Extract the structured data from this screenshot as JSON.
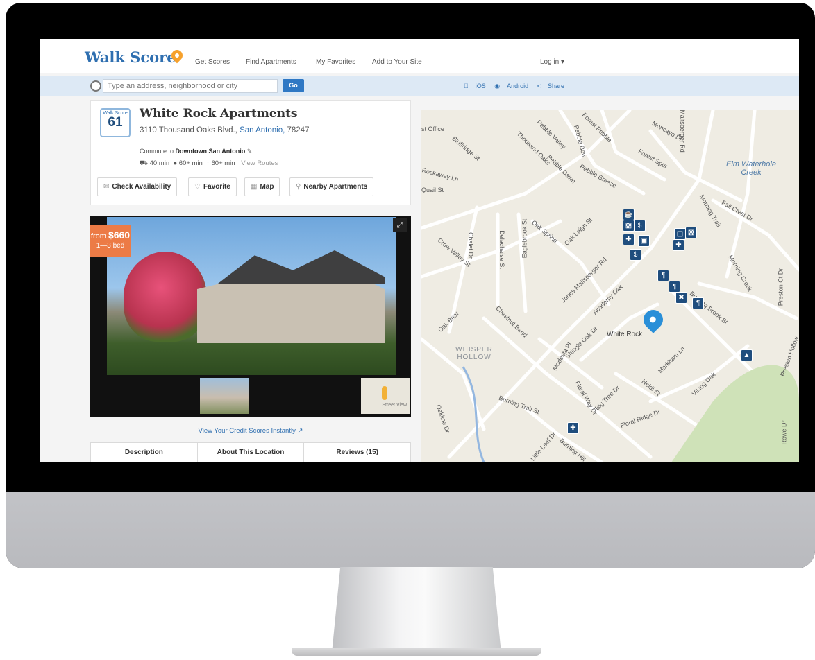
{
  "nav": {
    "logo": "Walk Score",
    "links": [
      "Get Scores",
      "Find Apartments",
      "My Favorites",
      "Add to Your Site"
    ],
    "login": "Log in ▾"
  },
  "search": {
    "placeholder": "Type an address, neighborhood or city",
    "go": "Go",
    "ios": "iOS",
    "android": "Android",
    "share": "Share"
  },
  "listing": {
    "badge_label": "Walk Score",
    "score": "61",
    "title": "White Rock Apartments",
    "street": "3110 Thousand Oaks Blvd.,",
    "city": "San Antonio,",
    "zip": "78247",
    "commute_prefix": "Commute to",
    "commute_dest": "Downtown San Antonio",
    "drive": "40 min",
    "bike": "60+ min",
    "walk": "60+ min",
    "routes": "View Routes"
  },
  "actions": {
    "check": "Check Availability",
    "favorite": "Favorite",
    "map": "Map",
    "nearby": "Nearby Apartments"
  },
  "photo": {
    "from": "from",
    "price": "$660",
    "beds": "1—3 bed",
    "streetview": "Street View"
  },
  "credit_link": "View Your Credit Scores Instantly",
  "tabs": [
    "Description",
    "About This Location",
    "Reviews (15)"
  ],
  "map": {
    "pin_label": "White Rock",
    "area": "WHISPER HOLLOW",
    "water": "Elm Waterhole Creek",
    "streets": [
      "Bluffridge St",
      "Rockaway Ln",
      "Quail St",
      "Crow Valley St",
      "Chalet Dr",
      "Delachaise St",
      "Eaglebrook St",
      "Oak Spring",
      "Oak Leigh St",
      "Jones Maltsberger Rd",
      "Academy Oak",
      "Chestnut Bend",
      "Shingle Oak Dr",
      "Modesta Pl",
      "Oak Briar",
      "Burning Trail St",
      "Floral Way Dr",
      "Big Tree Dr",
      "Floral Ridge Dr",
      "Heidi St",
      "Viking Oak",
      "Markham Ln",
      "Morning Creek",
      "Morning Trail",
      "Fall Crest Dr",
      "Forest Spur",
      "Moncayo Dr",
      "Maltsberger Rd",
      "Pebble Valley",
      "Pebble Bow",
      "Pebble Dawn",
      "Pebble Breeze",
      "Forest Pebble",
      "Thousand Oaks",
      "Preston Ct Dr",
      "Preston Hollow",
      "Rowe Dr",
      "Oakline Dr",
      "Little Leaf Dr",
      "Burning Hill",
      "Burning Brook St",
      "st Office"
    ]
  },
  "colors": {
    "brand": "#2f6fb0",
    "accent": "#ec7b46",
    "pin": "#2a8fd8",
    "poi": "#1f4d7d"
  }
}
